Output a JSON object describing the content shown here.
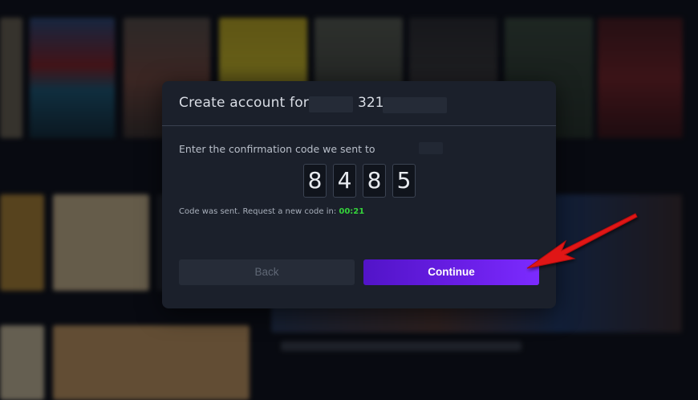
{
  "modal": {
    "title_prefix": "Create account for",
    "title_suffix": "321",
    "instruction": "Enter the confirmation code we sent to",
    "code_digits": [
      "8",
      "4",
      "8",
      "5"
    ],
    "resend_text": "Code was sent. Request a new code in:",
    "resend_timer": "00:21",
    "back_label": "Back",
    "continue_label": "Continue"
  },
  "colors": {
    "timer": "#35d43b",
    "continue_start": "#5214c8",
    "continue_end": "#7c2bff",
    "annotation_arrow": "#e01414"
  }
}
